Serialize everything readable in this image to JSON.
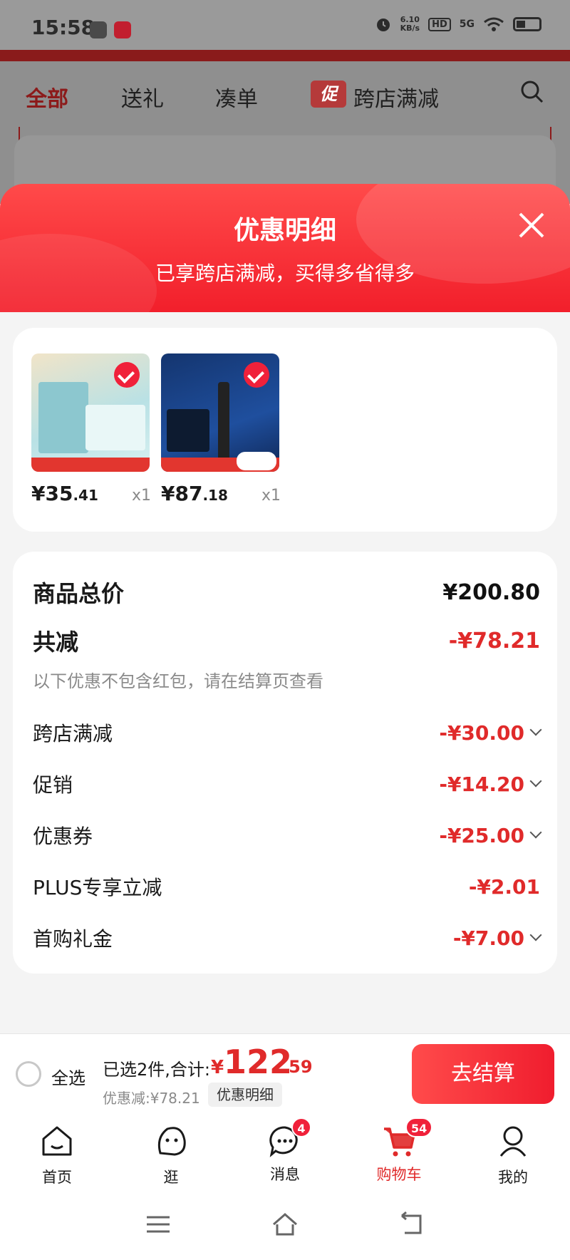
{
  "status_bar": {
    "time": "15:58",
    "speed_value": "6.10",
    "speed_unit": "KB/s",
    "hd": "HD",
    "network": "5G"
  },
  "top_tabs": [
    "全部",
    "送礼",
    "凑单",
    "跨店满减"
  ],
  "promo_tag": "促",
  "sheet": {
    "title": "优惠明细",
    "subtitle": "已享跨店满减，买得多省得多"
  },
  "products": [
    {
      "price_int": "¥35",
      "price_dec": ".41",
      "qty": "x1"
    },
    {
      "price_int": "¥87",
      "price_dec": ".18",
      "qty": "x1"
    }
  ],
  "summary": {
    "total_label": "商品总价",
    "total_value": "¥200.80",
    "reduce_label": "共减",
    "reduce_value": "-¥78.21",
    "note": "以下优惠不包含红包，请在结算页查看",
    "items": [
      {
        "label": "跨店满减",
        "value": "-¥30.00"
      },
      {
        "label": "促销",
        "value": "-¥14.20"
      },
      {
        "label": "优惠券",
        "value": "-¥25.00"
      },
      {
        "label": "PLUS专享立减",
        "value": "-¥2.01"
      },
      {
        "label": "首购礼金",
        "value": "-¥7.00"
      }
    ]
  },
  "checkout": {
    "select_all": "全选",
    "selected_text": "已选2件,合计:",
    "total_symbol": "¥",
    "total_int": "122",
    "total_dec": ".59",
    "discount_text": "优惠减:¥78.21",
    "detail_button": "优惠明细",
    "pay_button": "去结算"
  },
  "bottom_nav": [
    {
      "label": "首页"
    },
    {
      "label": "逛"
    },
    {
      "label": "消息",
      "badge": "4"
    },
    {
      "label": "购物车",
      "badge": "54"
    },
    {
      "label": "我的"
    }
  ],
  "colors": {
    "accent": "#e02a2a",
    "header_red": "#f21f2b"
  }
}
